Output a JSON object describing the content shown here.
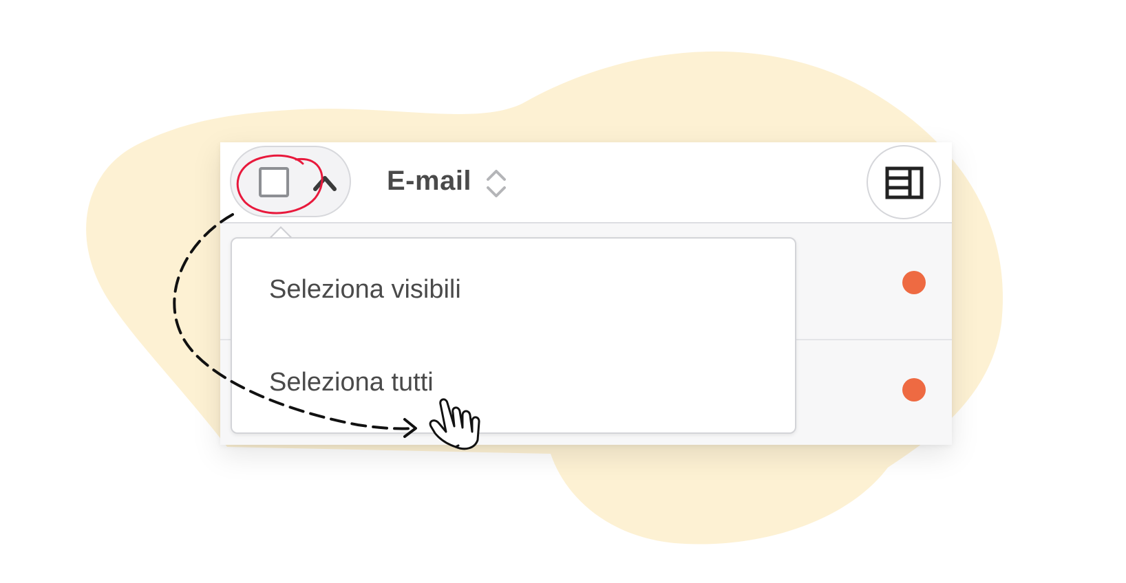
{
  "table": {
    "column_title": "E-mail",
    "sort_icon": "sort-up-down-icon",
    "caret_icon": "chevron-up-icon",
    "columns_icon": "column-layout-icon",
    "checkbox_checked": false
  },
  "dropdown": {
    "items": [
      {
        "label": "Seleziona visibili"
      },
      {
        "label": "Seleziona tutti"
      }
    ]
  },
  "rows": [
    {
      "status_color": "#ee6a42"
    },
    {
      "status_color": "#ee6a42"
    }
  ],
  "colors": {
    "background_blob": "#fdf1d3",
    "annotation_circle": "#e8193c",
    "annotation_arrow": "#111111",
    "status_dot": "#ee6a42"
  }
}
